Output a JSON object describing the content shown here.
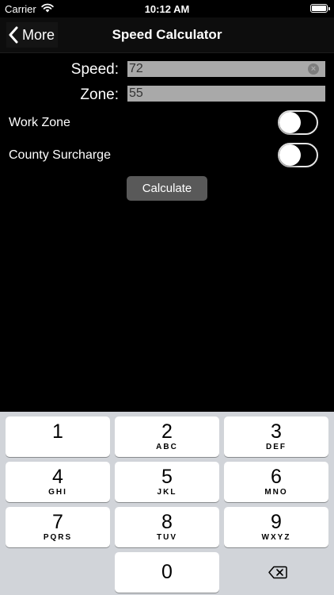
{
  "status_bar": {
    "carrier": "Carrier",
    "time": "10:12 AM",
    "icons": [
      "wifi-icon",
      "battery-icon"
    ]
  },
  "nav": {
    "back_label": "More",
    "title": "Speed Calculator",
    "back_icon": "chevron-left-icon"
  },
  "form": {
    "speed_label": "Speed:",
    "speed_value": "72",
    "zone_label": "Zone:",
    "zone_value": "55",
    "work_zone_label": "Work Zone",
    "work_zone_on": false,
    "county_surcharge_label": "County Surcharge",
    "county_surcharge_on": false,
    "calculate_label": "Calculate"
  },
  "keypad": {
    "keys": [
      {
        "digit": "1",
        "letters": ""
      },
      {
        "digit": "2",
        "letters": "ABC"
      },
      {
        "digit": "3",
        "letters": "DEF"
      },
      {
        "digit": "4",
        "letters": "GHI"
      },
      {
        "digit": "5",
        "letters": "JKL"
      },
      {
        "digit": "6",
        "letters": "MNO"
      },
      {
        "digit": "7",
        "letters": "PQRS"
      },
      {
        "digit": "8",
        "letters": "TUV"
      },
      {
        "digit": "9",
        "letters": "WXYZ"
      },
      {
        "digit": "0",
        "letters": ""
      }
    ],
    "delete_icon": "backspace-icon"
  },
  "colors": {
    "background": "#000000",
    "field_bg": "#a9a9a9",
    "button_bg": "#595959",
    "keypad_bg": "#d1d4d9",
    "key_bg": "#ffffff"
  }
}
